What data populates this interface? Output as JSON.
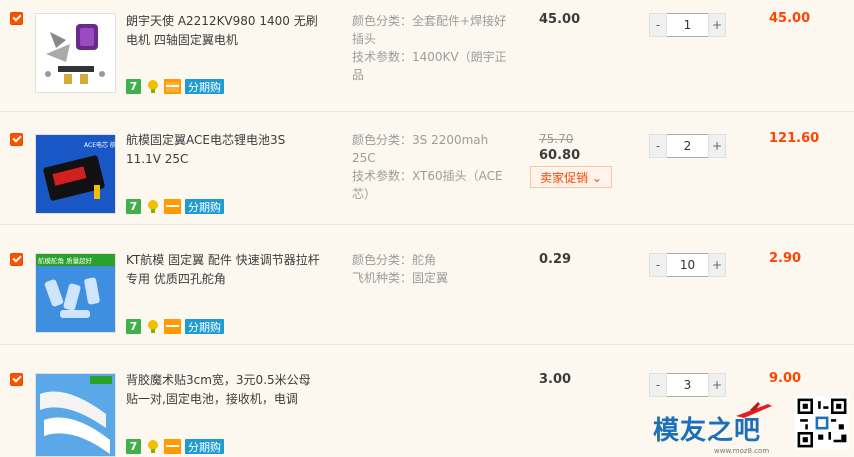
{
  "items": [
    {
      "title": "朗宇天使 A2212KV980 1400 无刷电机 四轴固定翼电机",
      "spec1_label": "颜色分类：",
      "spec1_value": "全套配件+焊接好插头",
      "spec2_label": "技术参数：",
      "spec2_value": "1400KV（朗宇正品",
      "price": "45.00",
      "qty": "1",
      "subtotal": "45.00"
    },
    {
      "title": "航模固定翼ACE电芯锂电池3S 11.1V 25C",
      "spec1_label": "颜色分类：",
      "spec1_value": "3S 2200mah 25C",
      "spec2_label": "技术参数：",
      "spec2_value": "XT60插头（ACE芯）",
      "old_price": "75.70",
      "price": "60.80",
      "promo": "卖家促销 ⌄",
      "qty": "2",
      "subtotal": "121.60"
    },
    {
      "title": "KT航模 固定翼 配件 快速调节器拉杆专用 优质四孔舵角",
      "spec1_label": "颜色分类：",
      "spec1_value": "舵角",
      "spec2_label": "飞机种类：",
      "spec2_value": "固定翼",
      "price": "0.29",
      "qty": "10",
      "subtotal": "2.90"
    },
    {
      "title": "背胶魔术贴3cm宽，3元0.5米公母贴一对,固定电池，接收机，电调",
      "price": "3.00",
      "qty": "3",
      "subtotal": "9.00"
    }
  ],
  "badges": {
    "seven": "7",
    "installment": "分期购"
  },
  "qty_controls": {
    "minus": "-",
    "plus": "+"
  },
  "thumb_labels": {
    "item2": "ACE电芯 航模首选",
    "item3": "航模舵角 质量超好"
  },
  "watermark": {
    "brand": "模友之吧",
    "url": "www.moz8.com"
  },
  "colors": {
    "accent": "#ff4400",
    "checkbox": "#ff5000",
    "installment_badge": "#1f9ccf",
    "seven_badge": "#3fb04a",
    "background": "#fcf8ef"
  }
}
